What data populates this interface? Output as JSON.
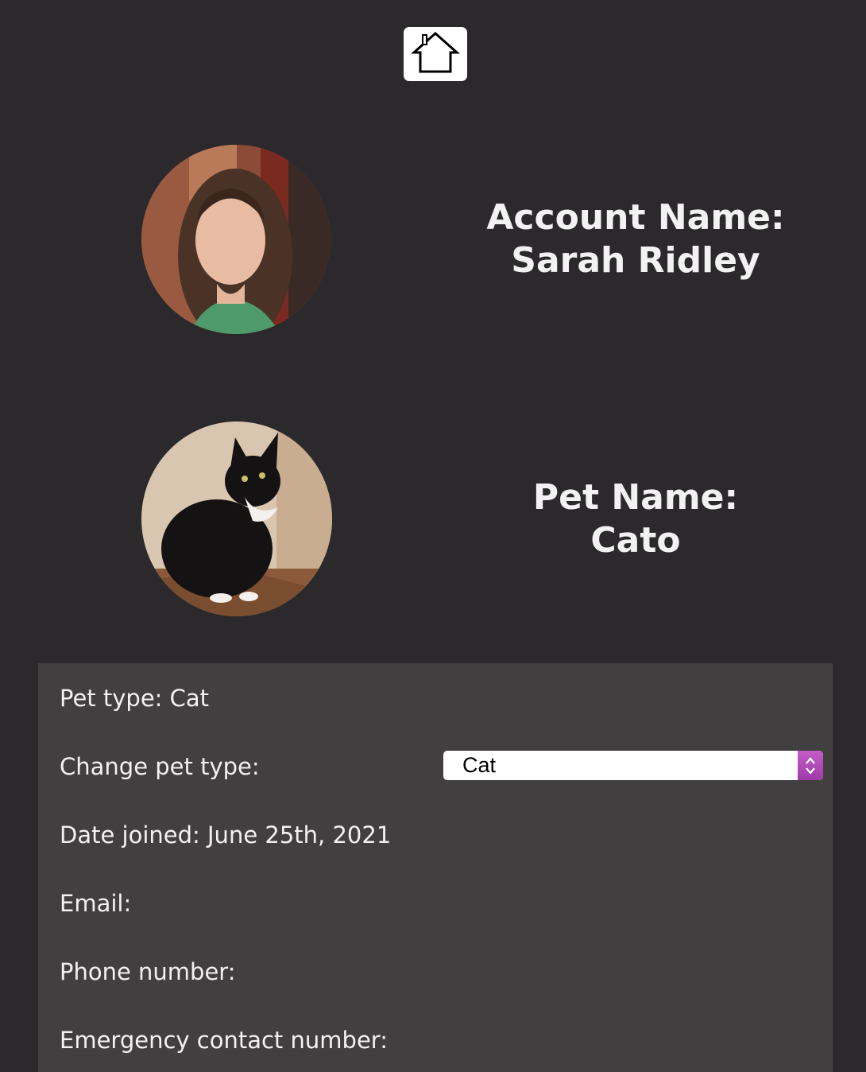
{
  "nav": {
    "home_icon": "home-icon"
  },
  "account": {
    "label": "Account Name:",
    "name": "Sarah Ridley"
  },
  "pet": {
    "label": "Pet Name:",
    "name": "Cato"
  },
  "details": {
    "pet_type": "Pet type: Cat",
    "change_label": "Change pet type:",
    "select_value": "Cat",
    "date_joined": "Date joined: June 25th, 2021",
    "email_label": "Email:",
    "phone_label": "Phone number:",
    "emergency_label": "Emergency contact number:"
  },
  "colors": {
    "background": "#2b292b",
    "panel": "#423f40",
    "select_accent": "#b24db9"
  }
}
